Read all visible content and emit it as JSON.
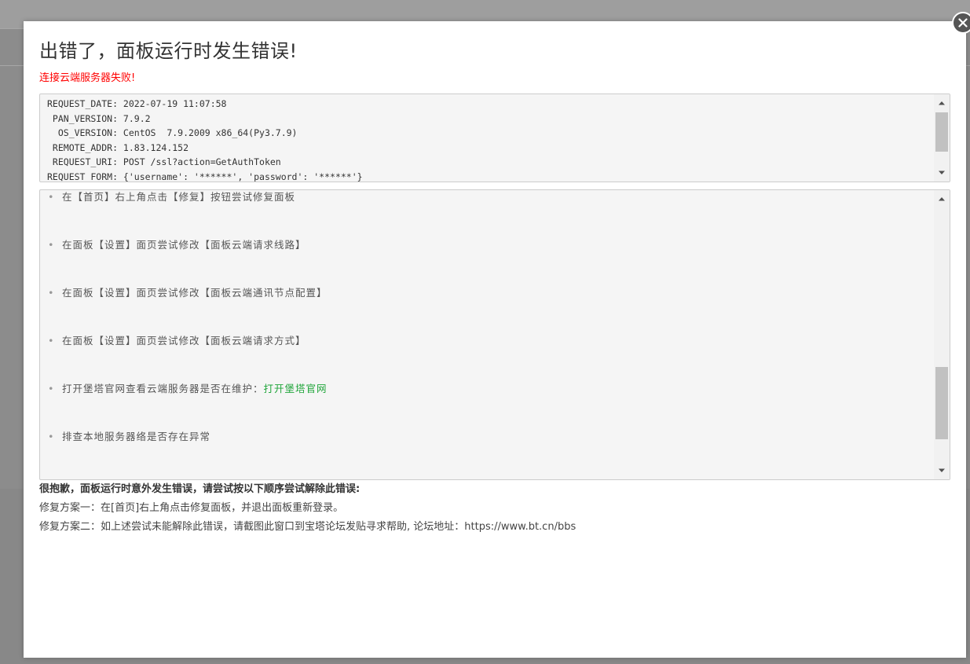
{
  "dialog": {
    "title": "出错了，面板运行时发生错误!",
    "subtitle": "连接云端服务器失败!",
    "close_icon": "close-icon"
  },
  "request_info": [
    "REQUEST_DATE: 2022-07-19 11:07:58",
    " PAN_VERSION: 7.9.2",
    "  OS_VERSION: CentOS  7.9.2009 x86_64(Py3.7.9)",
    " REMOTE_ADDR: 1.83.124.152",
    " REQUEST_URI: POST /ssl?action=GetAuthToken",
    "REQUEST_FORM: {'username': '******', 'password': '******'}"
  ],
  "tips": [
    {
      "text": "在【首页】右上角点击【修复】按钮尝试修复面板",
      "link": ""
    },
    {
      "text": "在面板【设置】面页尝试修改【面板云端请求线路】",
      "link": ""
    },
    {
      "text": "在面板【设置】面页尝试修改【面板云端通讯节点配置】",
      "link": ""
    },
    {
      "text": "在面板【设置】面页尝试修改【面板云端请求方式】",
      "link": ""
    },
    {
      "text": "打开堡塔官网查看云端服务器是否在维护：",
      "link": "打开堡塔官网"
    },
    {
      "text": "排查本地服务器络是否存在异常",
      "link": ""
    }
  ],
  "notes": {
    "heading": "很抱歉，面板运行时意外发生错误，请尝试按以下顺序尝试解除此错误:",
    "plan1": "修复方案一：在[首页]右上角点击修复面板，并退出面板重新登录。",
    "plan2": "修复方案二：如上述尝试未能解除此错误，请截图此窗口到宝塔论坛发贴寻求帮助, 论坛地址：https://www.bt.cn/bbs"
  },
  "colors": {
    "error_red": "#ff0000",
    "link_green": "#20a53a",
    "overlay": "#8c8c8c"
  }
}
